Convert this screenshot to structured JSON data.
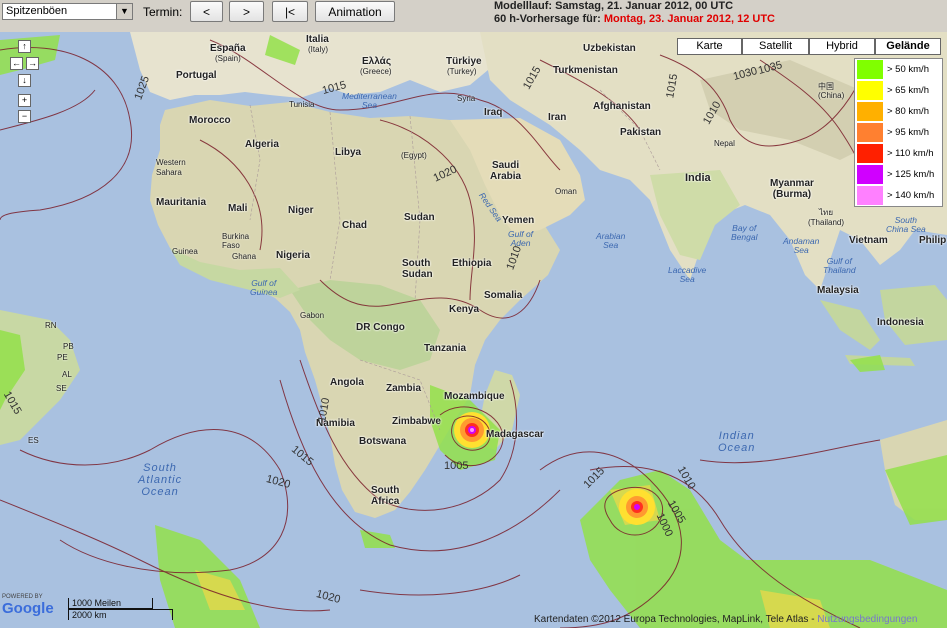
{
  "toolbar": {
    "product_select": "Spitzenböen",
    "termin_label": "Termin:",
    "prev_label": "<",
    "next_label": ">",
    "first_label": "|<",
    "animation_label": "Animation",
    "model_run": "Modelllauf: Samstag, 21. Januar 2012, 00 UTC",
    "forecast_prefix": "60 h-Vorhersage für: ",
    "forecast_time": "Montag, 23. Januar 2012, 12 UTC"
  },
  "map_types": [
    "Karte",
    "Satellit",
    "Hybrid",
    "Gelände"
  ],
  "active_map_type": "Gelände",
  "legend": [
    {
      "label": "> 50 km/h",
      "color": "#80ff00"
    },
    {
      "label": "> 65 km/h",
      "color": "#ffff00"
    },
    {
      "label": "> 80 km/h",
      "color": "#ffb000"
    },
    {
      "label": "> 95 km/h",
      "color": "#ff8030"
    },
    {
      "label": "> 110 km/h",
      "color": "#ff2000"
    },
    {
      "label": "> 125 km/h",
      "color": "#d000ff"
    },
    {
      "label": "> 140 km/h",
      "color": "#ff80ff"
    }
  ],
  "places": {
    "espana": "España",
    "spain": "(Spain)",
    "italia": "Italia",
    "italy": "(Italy)",
    "ellas": "Ελλάς",
    "greece": "(Greece)",
    "turkiye": "Türkiye",
    "turkey": "(Turkey)",
    "portugal": "Portugal",
    "tunisia": "Tunisia",
    "morocco": "Morocco",
    "algeria": "Algeria",
    "libya": "Libya",
    "egypt": "(Egypt)",
    "western_sahara": "Western\nSahara",
    "mauritania": "Mauritania",
    "mali": "Mali",
    "niger": "Niger",
    "chad": "Chad",
    "sudan": "Sudan",
    "burkina": "Burkina\nFaso",
    "guinea": "Guinea",
    "ghana": "Ghana",
    "nigeria": "Nigeria",
    "gabon": "Gabon",
    "dr_congo": "DR Congo",
    "south_sudan": "South\nSudan",
    "ethiopia": "Ethiopia",
    "somalia": "Somalia",
    "kenya": "Kenya",
    "tanzania": "Tanzania",
    "angola": "Angola",
    "zambia": "Zambia",
    "mozambique": "Mozambique",
    "zimbabwe": "Zimbabwe",
    "namibia": "Namibia",
    "botswana": "Botswana",
    "madagascar": "Madagascar",
    "south_africa": "South\nAfrica",
    "syria": "Syria",
    "iraq": "Iraq",
    "iran": "Iran",
    "saudi": "Saudi\nArabia",
    "yemen": "Yemen",
    "oman": "Oman",
    "uzbekistan": "Uzbekistan",
    "turkmenistan": "Turkmenistan",
    "afghanistan": "Afghanistan",
    "pakistan": "Pakistan",
    "nepal": "Nepal",
    "india": "India",
    "china": "中国\n(China)",
    "myanmar": "Myanmar\n(Burma)",
    "thailand": "ไทย\n(Thailand)",
    "vietnam": "Vietnam",
    "philip": "Philip",
    "malaysia": "Malaysia",
    "indonesia": "Indonesia",
    "rn": "RN",
    "pb": "PB",
    "pe": "PE",
    "al": "AL",
    "se": "SE",
    "es": "ES"
  },
  "seas": {
    "med": "Mediterranean\nSea",
    "red": "Red Sea",
    "gulf_aden": "Gulf of\nAden",
    "arabian": "Arabian\nSea",
    "laccadive": "Laccadive\nSea",
    "bengal": "Bay of\nBengal",
    "andaman": "Andaman\nSea",
    "gulf_thai": "Gulf of\nThailand",
    "scs": "South\nChina Sea",
    "guinea_gulf": "Gulf of\nGuinea"
  },
  "oceans": {
    "south_atlantic": "South\nAtlantic\nOcean",
    "indian": "Indian\nOcean"
  },
  "isobars": [
    "1025",
    "1015",
    "1020",
    "1015",
    "1010",
    "1015",
    "1010",
    "1005",
    "1015",
    "1020",
    "1020",
    "1010",
    "1005",
    "1000",
    "1015",
    "1035",
    "1030",
    "1010",
    "1015"
  ],
  "footer": {
    "attribution": "Kartendaten ©2012 Europa Technologies, MapLink, Tele Atlas - ",
    "terms": "Nutzungsbedingungen",
    "powered": "POWERED BY",
    "google": "Google",
    "scale_mi": "1000 Meilen",
    "scale_km": "2000 km"
  }
}
